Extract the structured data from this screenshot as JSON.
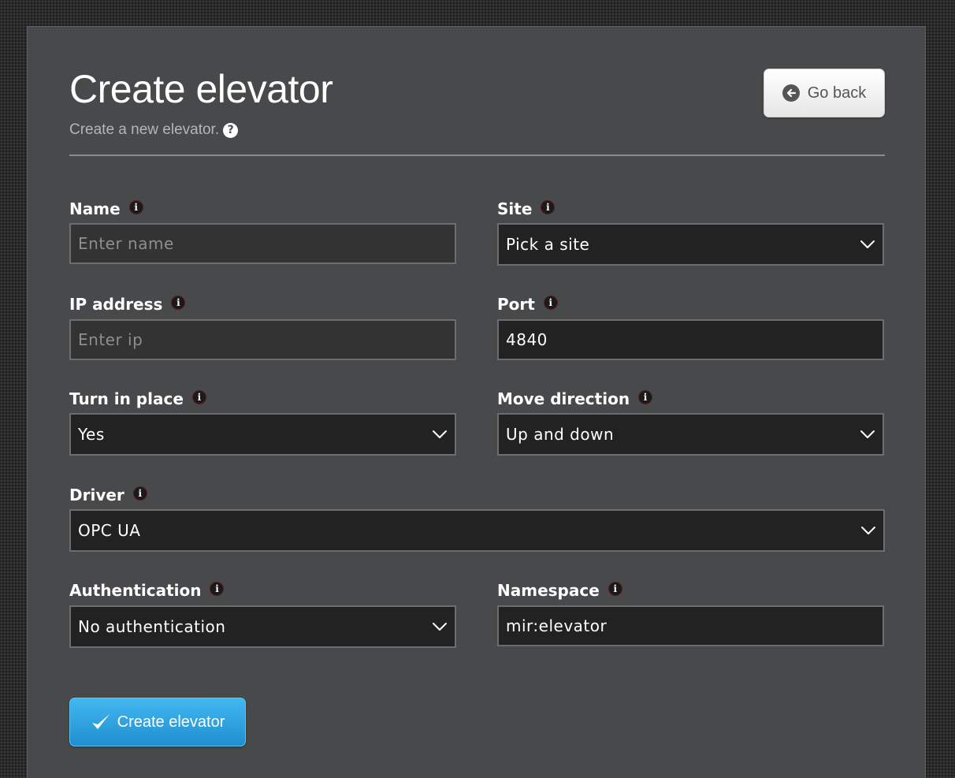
{
  "header": {
    "title": "Create elevator",
    "subtitle": "Create a new elevator.",
    "help_icon": "question-circle-icon",
    "go_back_label": "Go back",
    "go_back_icon": "arrow-left-circle-icon"
  },
  "form": {
    "name": {
      "label": "Name",
      "placeholder": "Enter name",
      "value": ""
    },
    "site": {
      "label": "Site",
      "value": "Pick a site"
    },
    "ip_address": {
      "label": "IP address",
      "placeholder": "Enter ip",
      "value": ""
    },
    "port": {
      "label": "Port",
      "value": "4840"
    },
    "turn_in_place": {
      "label": "Turn in place",
      "value": "Yes"
    },
    "move_direction": {
      "label": "Move direction",
      "value": "Up and down"
    },
    "driver": {
      "label": "Driver",
      "value": "OPC UA"
    },
    "authentication": {
      "label": "Authentication",
      "value": "No authentication"
    },
    "namespace": {
      "label": "Namespace",
      "value": "mir:elevator"
    }
  },
  "actions": {
    "create_label": "Create elevator",
    "create_icon": "checkmark-icon"
  },
  "colors": {
    "panel_bg": "#48494b",
    "field_bg": "#222222",
    "accent_blue": "#2b9fe0"
  }
}
